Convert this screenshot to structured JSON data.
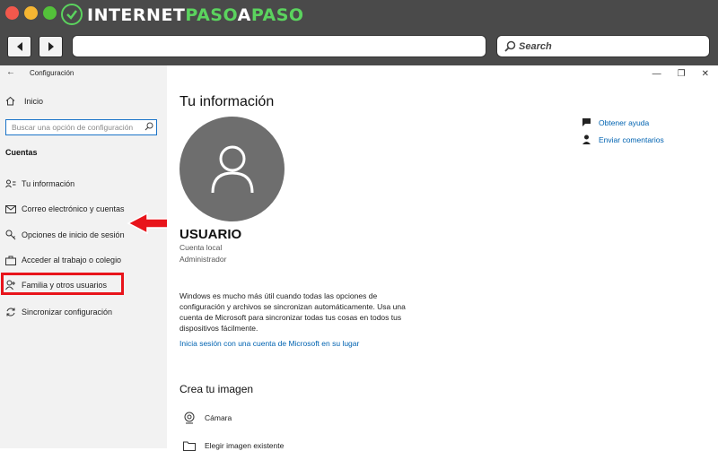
{
  "browser": {
    "logo": {
      "part1": "INTERNET",
      "part2": "PASO",
      "part3": "A",
      "part4": "PASO"
    },
    "search_label": "Search",
    "colors": {
      "chrome": "#4a4a4a",
      "logo_accent": "#5bd35e"
    }
  },
  "window": {
    "title": "Configuración",
    "controls": {
      "minimize": "—",
      "maximize": "❐",
      "close": "✕"
    }
  },
  "sidebar": {
    "home_label": "Inicio",
    "search_placeholder": "Buscar una opción de configuración",
    "section": "Cuentas",
    "items": [
      {
        "label": "Tu información",
        "icon": "user-card-icon"
      },
      {
        "label": "Correo electrónico y cuentas",
        "icon": "mail-icon"
      },
      {
        "label": "Opciones de inicio de sesión",
        "icon": "key-icon"
      },
      {
        "label": "Acceder al trabajo o colegio",
        "icon": "briefcase-icon"
      },
      {
        "label": "Familia y otros usuarios",
        "icon": "person-add-icon"
      },
      {
        "label": "Sincronizar configuración",
        "icon": "sync-icon"
      }
    ],
    "highlight_color": "#e8141b"
  },
  "main": {
    "title": "Tu información",
    "user": {
      "name": "USUARIO",
      "account_type": "Cuenta local",
      "role": "Administrador"
    },
    "info_text": "Windows es mucho más útil cuando todas las opciones de configuración y archivos se sincronizan automáticamente. Usa una cuenta de Microsoft para sincronizar todas tus cosas en todos tus dispositivos fácilmente.",
    "ms_link": "Inicia sesión con una cuenta de Microsoft en su lugar",
    "create_image_title": "Crea tu imagen",
    "image_options": [
      {
        "label": "Cámara",
        "icon": "webcam-icon"
      },
      {
        "label": "Elegir imagen existente",
        "icon": "folder-icon"
      }
    ],
    "help_links": [
      {
        "label": "Obtener ayuda",
        "icon": "help-chat-icon"
      },
      {
        "label": "Enviar comentarios",
        "icon": "feedback-icon"
      }
    ]
  }
}
